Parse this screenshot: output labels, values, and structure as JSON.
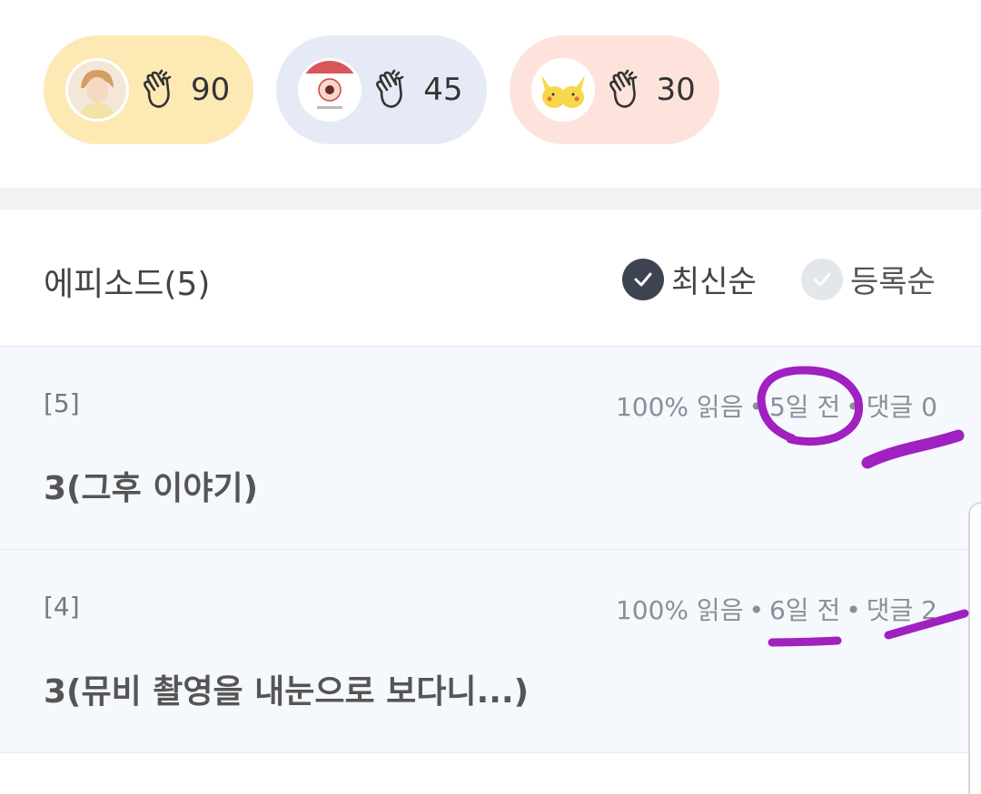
{
  "supporters": [
    {
      "avatar": "person-avatar",
      "count": "90",
      "bg": "#fde9b4"
    },
    {
      "avatar": "badge-avatar",
      "count": "45",
      "bg": "#e6eaf6"
    },
    {
      "avatar": "pikachu-avatar",
      "count": "30",
      "bg": "#fde3dc"
    }
  ],
  "episodes_header": {
    "title": "에피소드(5)",
    "sort_latest": "최신순",
    "sort_registered": "등록순",
    "active_sort": "latest"
  },
  "episodes": [
    {
      "num": "[5]",
      "read": "100% 읽음",
      "date": "5일 전",
      "comments": "댓글 0",
      "title": "3(그후 이야기)"
    },
    {
      "num": "[4]",
      "read": "100% 읽음",
      "date": "6일 전",
      "comments": "댓글 2",
      "title": "3(뮤비 촬영을 내눈으로 보다니...)"
    }
  ],
  "colors": {
    "accent_dark": "#3d4350",
    "row_bg": "#f5f8fc",
    "annotation": "#a020c0"
  },
  "icons": {
    "clap": "clap-icon",
    "check": "check-icon"
  }
}
